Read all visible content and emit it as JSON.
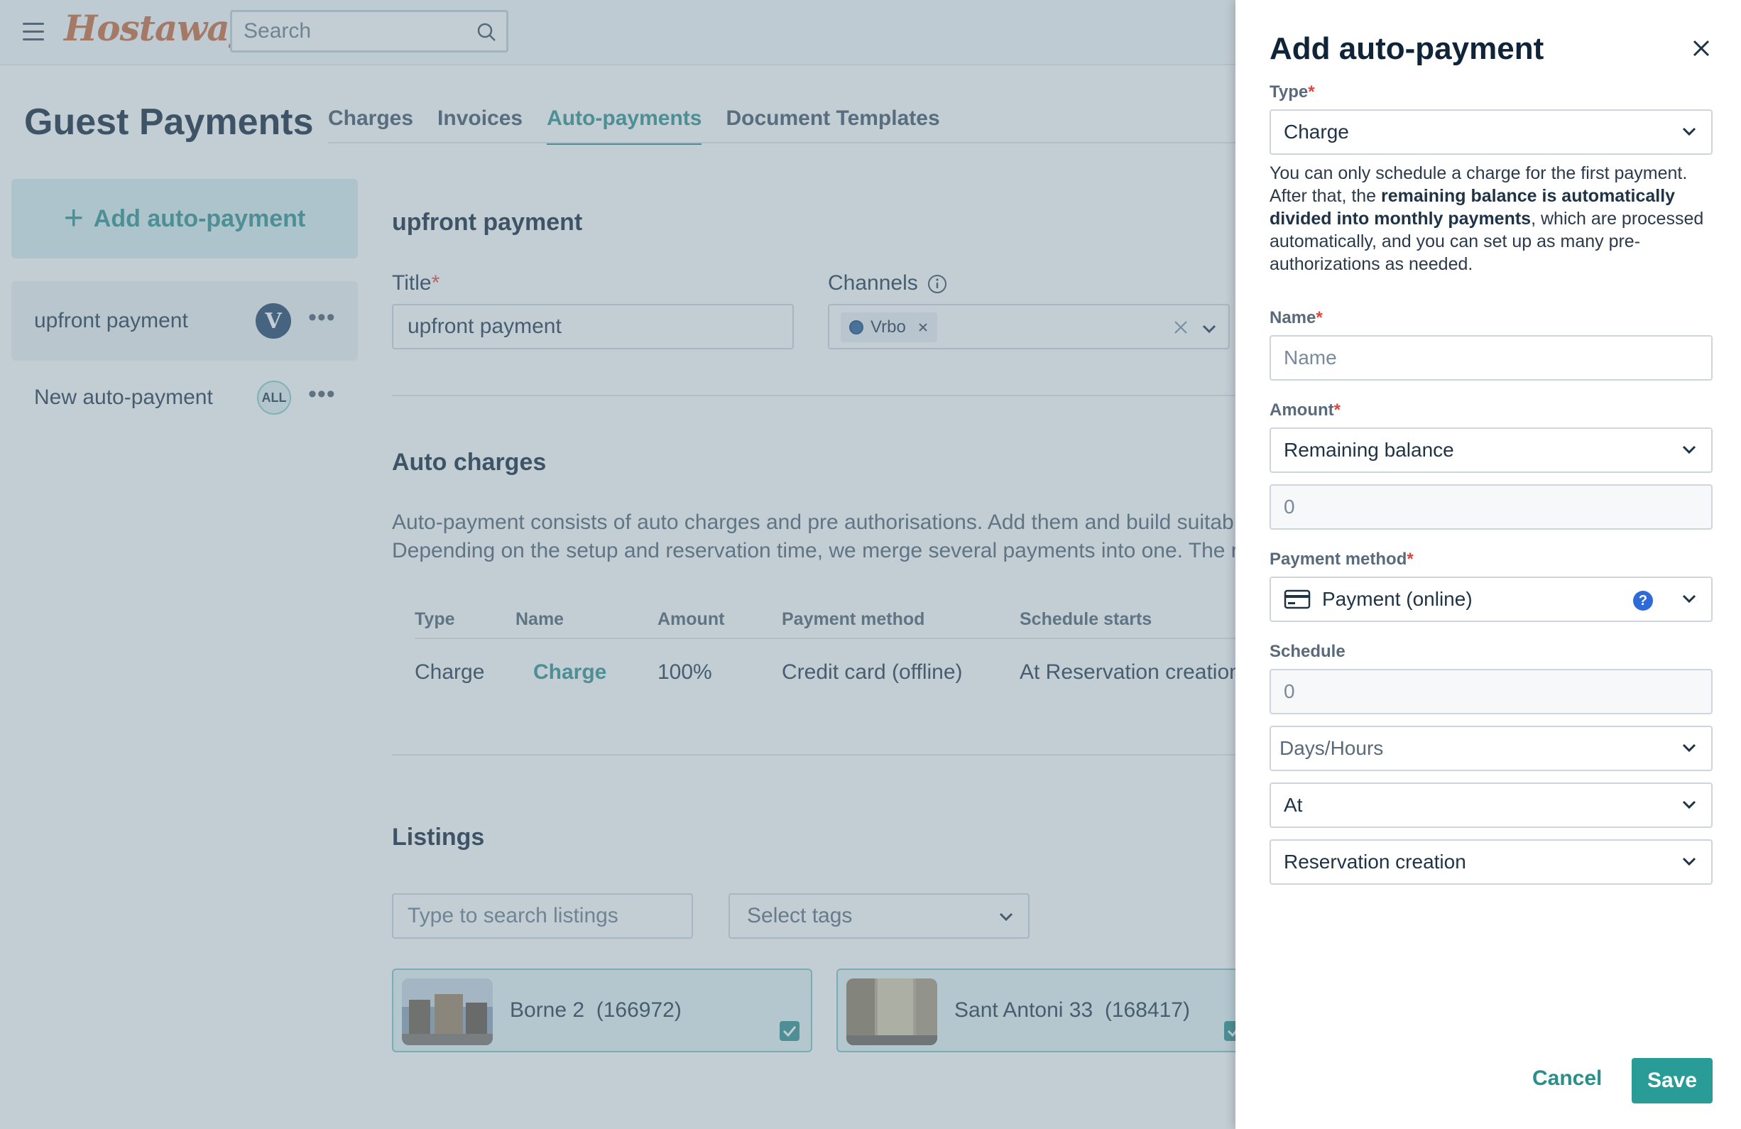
{
  "app": {
    "logo": "Hostaway",
    "search_placeholder": "Search"
  },
  "page": {
    "title": "Guest Payments",
    "tabs": [
      {
        "label": "Charges",
        "active": false
      },
      {
        "label": "Invoices",
        "active": false
      },
      {
        "label": "Auto-payments",
        "active": true
      },
      {
        "label": "Document Templates",
        "active": false
      }
    ]
  },
  "sidebar": {
    "add_label": "Add auto-payment",
    "items": [
      {
        "label": "upfront payment",
        "badge": "V",
        "selected": true
      },
      {
        "label": "New auto-payment",
        "badge": "ALL",
        "selected": false
      }
    ]
  },
  "detail": {
    "heading": "upfront payment",
    "title_label": "Title",
    "title_value": "upfront payment",
    "channels_label": "Channels",
    "channel_chip": "Vrbo",
    "auto_charges_heading": "Auto charges",
    "description_line1": "Auto-payment consists of auto charges and pre authorisations. Add them and build suitab",
    "description_line2": "Depending on the setup and reservation time, we merge several payments into one. The re",
    "table": {
      "headers": [
        "Type",
        "Name",
        "Amount",
        "Payment method",
        "Schedule starts"
      ],
      "row": [
        "Charge",
        "Charge",
        "100%",
        "Credit card (offline)",
        "At Reservation creation"
      ]
    },
    "listings_heading": "Listings",
    "listing_search_placeholder": "Type to search listings",
    "tags_placeholder": "Select tags",
    "listings": [
      {
        "name": "Borne 2",
        "id": "(166972)"
      },
      {
        "name": "Sant Antoni 33",
        "id": "(168417)"
      }
    ]
  },
  "drawer": {
    "title": "Add auto-payment",
    "type_label": "Type",
    "type_value": "Charge",
    "help_text_1": "You can only schedule a charge for the first payment. After that, the ",
    "help_bold": "remaining balance is automatically divided into monthly payments",
    "help_text_2": ", which are processed automatically, and you can set up as many pre-authorizations as needed.",
    "name_label": "Name",
    "name_placeholder": "Name",
    "amount_label": "Amount",
    "amount_value": "Remaining balance",
    "amount_input": "0",
    "payment_method_label": "Payment method",
    "payment_method_value": "Payment (online)",
    "schedule_label": "Schedule",
    "schedule_input": "0",
    "schedule_unit": "Days/Hours",
    "schedule_relation": "At",
    "schedule_event": "Reservation creation",
    "cancel_label": "Cancel",
    "save_label": "Save",
    "required_mark": "*"
  },
  "colors": {
    "accent": "#2a8f8c",
    "required": "#e0443a",
    "brand_logo": "#c8683a"
  },
  "icons": [
    "hamburger-icon",
    "search-icon",
    "plus-icon",
    "more-icon",
    "info-icon",
    "close-icon",
    "chevron-down-icon",
    "credit-card-icon",
    "help-icon",
    "check-icon"
  ]
}
